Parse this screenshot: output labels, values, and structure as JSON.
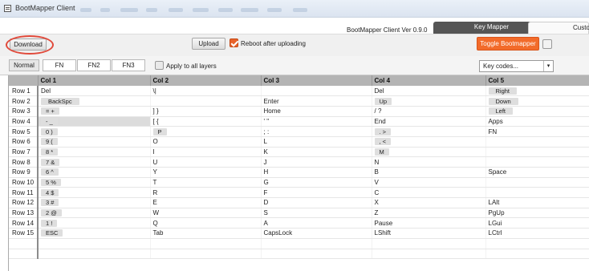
{
  "window": {
    "title": "BootMapper Client"
  },
  "info": {
    "version": "BootMapper Client Ver 0.9.0",
    "tabs": [
      {
        "label": "Key Mapper"
      },
      {
        "label": "Custo"
      }
    ]
  },
  "toolbar": {
    "download_label": "Download",
    "upload_label": "Upload",
    "reboot_label": "Reboot after uploading",
    "toggle_label": "Toggle Bootmapper",
    "accent_color": "#f26b2a"
  },
  "layers": {
    "buttons": [
      {
        "label": "Normal"
      },
      {
        "label": "FN"
      },
      {
        "label": "FN2"
      },
      {
        "label": "FN3"
      }
    ],
    "apply_all_label": "Apply to all layers",
    "keycodes_value": "Key codes..."
  },
  "grid": {
    "columns": [
      "Col 1",
      "Col 2",
      "Col 3",
      "Col 4",
      "Col 5"
    ],
    "rows": [
      {
        "label": "Row 1",
        "cells": [
          [
            "Del",
            0
          ],
          [
            "\\|",
            0
          ],
          [
            "",
            0
          ],
          [
            "Del",
            0
          ],
          [
            "Right",
            1
          ]
        ]
      },
      {
        "label": "Row 2",
        "cells": [
          [
            "BackSpc",
            1
          ],
          [
            "",
            0
          ],
          [
            "Enter",
            0
          ],
          [
            "Up",
            1
          ],
          [
            "Down",
            1
          ]
        ]
      },
      {
        "label": "Row 3",
        "cells": [
          [
            "= +",
            1
          ],
          [
            "] }",
            0
          ],
          [
            "Home",
            0
          ],
          [
            "/ ?",
            0
          ],
          [
            "Left",
            1
          ]
        ]
      },
      {
        "label": "Row 4",
        "cells": [
          [
            "- _",
            1
          ],
          [
            "[ {",
            0
          ],
          [
            "' \"",
            0
          ],
          [
            "End",
            0
          ],
          [
            "Apps",
            0
          ]
        ]
      },
      {
        "label": "Row 5",
        "cells": [
          [
            "0 )",
            1
          ],
          [
            "P",
            1
          ],
          [
            "; :",
            0
          ],
          [
            ". >",
            1
          ],
          [
            "FN",
            0
          ]
        ]
      },
      {
        "label": "Row 6",
        "cells": [
          [
            "9 (",
            1
          ],
          [
            "O",
            0
          ],
          [
            "L",
            0
          ],
          [
            ", <",
            1
          ],
          [
            "",
            0
          ]
        ]
      },
      {
        "label": "Row 7",
        "cells": [
          [
            "8 *",
            1
          ],
          [
            "I",
            0
          ],
          [
            "K",
            0
          ],
          [
            "M",
            1
          ],
          [
            "",
            0
          ]
        ]
      },
      {
        "label": "Row 8",
        "cells": [
          [
            "7 &",
            1
          ],
          [
            "U",
            0
          ],
          [
            "J",
            0
          ],
          [
            "N",
            0
          ],
          [
            "",
            0
          ]
        ]
      },
      {
        "label": "Row 9",
        "cells": [
          [
            "6 ^",
            1
          ],
          [
            "Y",
            0
          ],
          [
            "H",
            0
          ],
          [
            "B",
            0
          ],
          [
            "Space",
            0
          ]
        ]
      },
      {
        "label": "Row 10",
        "cells": [
          [
            "5 %",
            1
          ],
          [
            "T",
            0
          ],
          [
            "G",
            0
          ],
          [
            "V",
            0
          ],
          [
            "",
            0
          ]
        ]
      },
      {
        "label": "Row 11",
        "cells": [
          [
            "4 $",
            1
          ],
          [
            "R",
            0
          ],
          [
            "F",
            0
          ],
          [
            "C",
            0
          ],
          [
            "",
            0
          ]
        ]
      },
      {
        "label": "Row 12",
        "cells": [
          [
            "3 #",
            1
          ],
          [
            "E",
            0
          ],
          [
            "D",
            0
          ],
          [
            "X",
            0
          ],
          [
            "LAlt",
            0
          ]
        ]
      },
      {
        "label": "Row 13",
        "cells": [
          [
            "2 @",
            1
          ],
          [
            "W",
            0
          ],
          [
            "S",
            0
          ],
          [
            "Z",
            0
          ],
          [
            "PgUp",
            0
          ]
        ]
      },
      {
        "label": "Row 14",
        "cells": [
          [
            "1 !",
            1
          ],
          [
            "Q",
            0
          ],
          [
            "A",
            0
          ],
          [
            "Pause",
            0
          ],
          [
            "LGui",
            0
          ]
        ]
      },
      {
        "label": "Row 15",
        "cells": [
          [
            "ESC",
            1
          ],
          [
            "Tab",
            0
          ],
          [
            "CapsLock",
            0
          ],
          [
            "LShift",
            0
          ],
          [
            "LCtrl",
            0
          ]
        ]
      }
    ]
  }
}
